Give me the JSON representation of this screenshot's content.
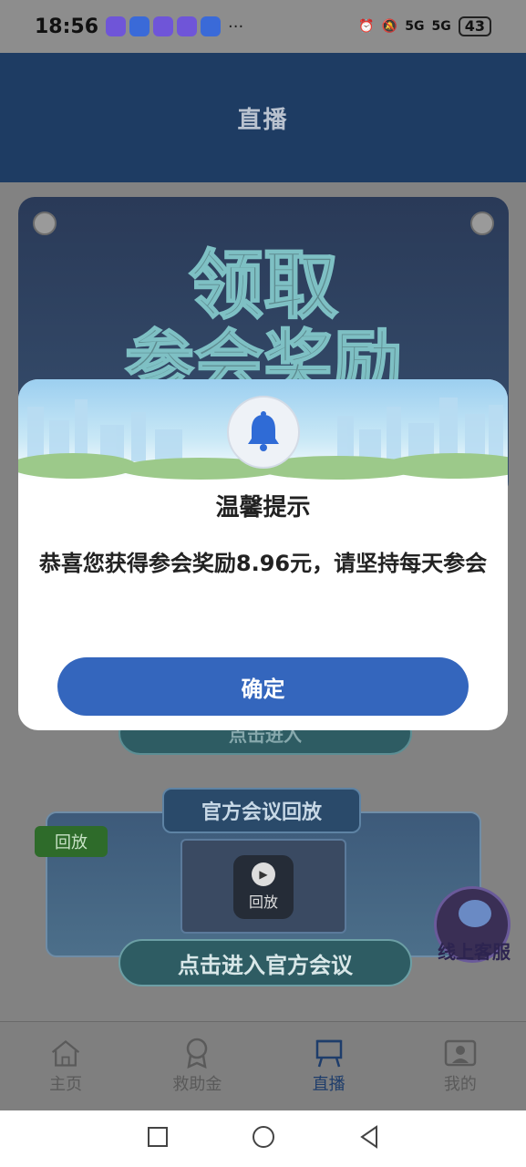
{
  "status_bar": {
    "time": "18:56",
    "more": "···",
    "signal_1": "5G",
    "signal_2": "5G",
    "battery": "43"
  },
  "header": {
    "title": "直播"
  },
  "banner": {
    "line1": "领取",
    "line2": "参会奖励"
  },
  "enter_top": {
    "label": "点击进入"
  },
  "replay": {
    "section_title": "官方会议回放",
    "tag": "回放",
    "play_label": "回放",
    "enter_label": "点击进入官方会议"
  },
  "customer_service": {
    "label": "线上客服"
  },
  "tabbar": {
    "items": [
      {
        "label": "主页",
        "icon": "home-icon"
      },
      {
        "label": "救助金",
        "icon": "medal-icon"
      },
      {
        "label": "直播",
        "icon": "easel-icon",
        "active": true
      },
      {
        "label": "我的",
        "icon": "profile-icon"
      }
    ]
  },
  "modal": {
    "title": "温馨提示",
    "message": "恭喜您获得参会奖励8.96元，请坚持每天参会",
    "confirm": "确定"
  },
  "colors": {
    "primary": "#3466bd",
    "header": "#1e3c63",
    "active_tab": "#1e3d6b"
  }
}
